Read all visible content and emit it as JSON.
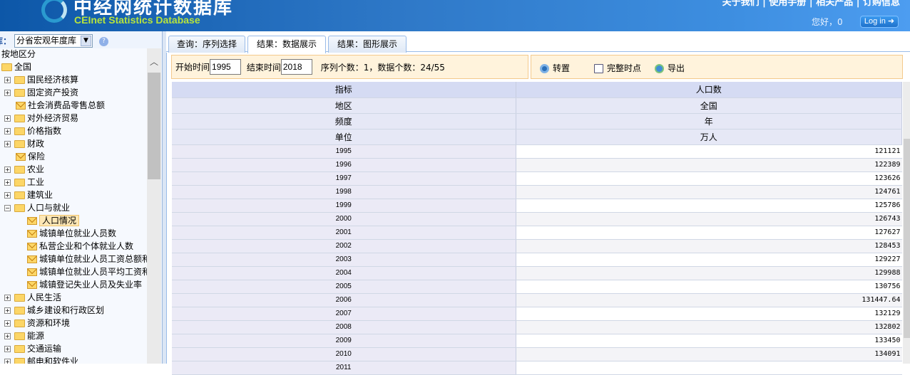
{
  "header": {
    "title_cn": "中经网统计数据库",
    "title_en": "CEInet Statistics Database",
    "top_nav": "关于我们 | 使用手册 | 相关产品 | 订购信息",
    "greeting": "您好，0",
    "login": "Log in ➜"
  },
  "sidebar": {
    "db_label": "库：",
    "db_selected": "分省宏观年度库",
    "category_label": "按地区分",
    "root": "全国",
    "items": [
      {
        "label": "国民经济核算",
        "type": "folder"
      },
      {
        "label": "固定资产投资",
        "type": "folder"
      },
      {
        "label": "社会消费品零售总额",
        "type": "leaf"
      },
      {
        "label": "对外经济贸易",
        "type": "folder"
      },
      {
        "label": "价格指数",
        "type": "folder"
      },
      {
        "label": "财政",
        "type": "folder"
      },
      {
        "label": "保险",
        "type": "leaf"
      },
      {
        "label": "农业",
        "type": "folder"
      },
      {
        "label": "工业",
        "type": "folder"
      },
      {
        "label": "建筑业",
        "type": "folder"
      },
      {
        "label": "人口与就业",
        "type": "open"
      },
      {
        "label": "人口情况",
        "type": "child",
        "selected": true
      },
      {
        "label": "城镇单位就业人员数",
        "type": "child"
      },
      {
        "label": "私营企业和个体就业人数",
        "type": "child"
      },
      {
        "label": "城镇单位就业人员工资总额和指数",
        "type": "child"
      },
      {
        "label": "城镇单位就业人员平均工资和指数",
        "type": "child"
      },
      {
        "label": "城镇登记失业人员及失业率",
        "type": "child"
      },
      {
        "label": "人民生活",
        "type": "folder"
      },
      {
        "label": "城乡建设和行政区划",
        "type": "folder"
      },
      {
        "label": "资源和环境",
        "type": "folder"
      },
      {
        "label": "能源",
        "type": "folder"
      },
      {
        "label": "交通运输",
        "type": "folder"
      },
      {
        "label": "邮电和软件业",
        "type": "folder"
      }
    ]
  },
  "tabs": [
    "查询：序列选择",
    "结果：数据展示",
    "结果：图形展示"
  ],
  "filter": {
    "start_label": "开始时间",
    "start": "1995",
    "end_label": "结束时间",
    "end": "2018",
    "summary": "序列个数：1，数据个数：24/55"
  },
  "tools": {
    "transpose": "转置",
    "complete": "完整时点",
    "export": "导出"
  },
  "table": {
    "meta": [
      [
        "指标",
        "人口数"
      ],
      [
        "地区",
        "全国"
      ],
      [
        "频度",
        "年"
      ],
      [
        "单位",
        "万人"
      ]
    ],
    "rows": [
      [
        "1995",
        "121121"
      ],
      [
        "1996",
        "122389"
      ],
      [
        "1997",
        "123626"
      ],
      [
        "1998",
        "124761"
      ],
      [
        "1999",
        "125786"
      ],
      [
        "2000",
        "126743"
      ],
      [
        "2001",
        "127627"
      ],
      [
        "2002",
        "128453"
      ],
      [
        "2003",
        "129227"
      ],
      [
        "2004",
        "129988"
      ],
      [
        "2005",
        "130756"
      ],
      [
        "2006",
        "131447.64"
      ],
      [
        "2007",
        "132129"
      ],
      [
        "2008",
        "132802"
      ],
      [
        "2009",
        "133450"
      ],
      [
        "2010",
        "134091"
      ],
      [
        "2011",
        ""
      ]
    ]
  }
}
